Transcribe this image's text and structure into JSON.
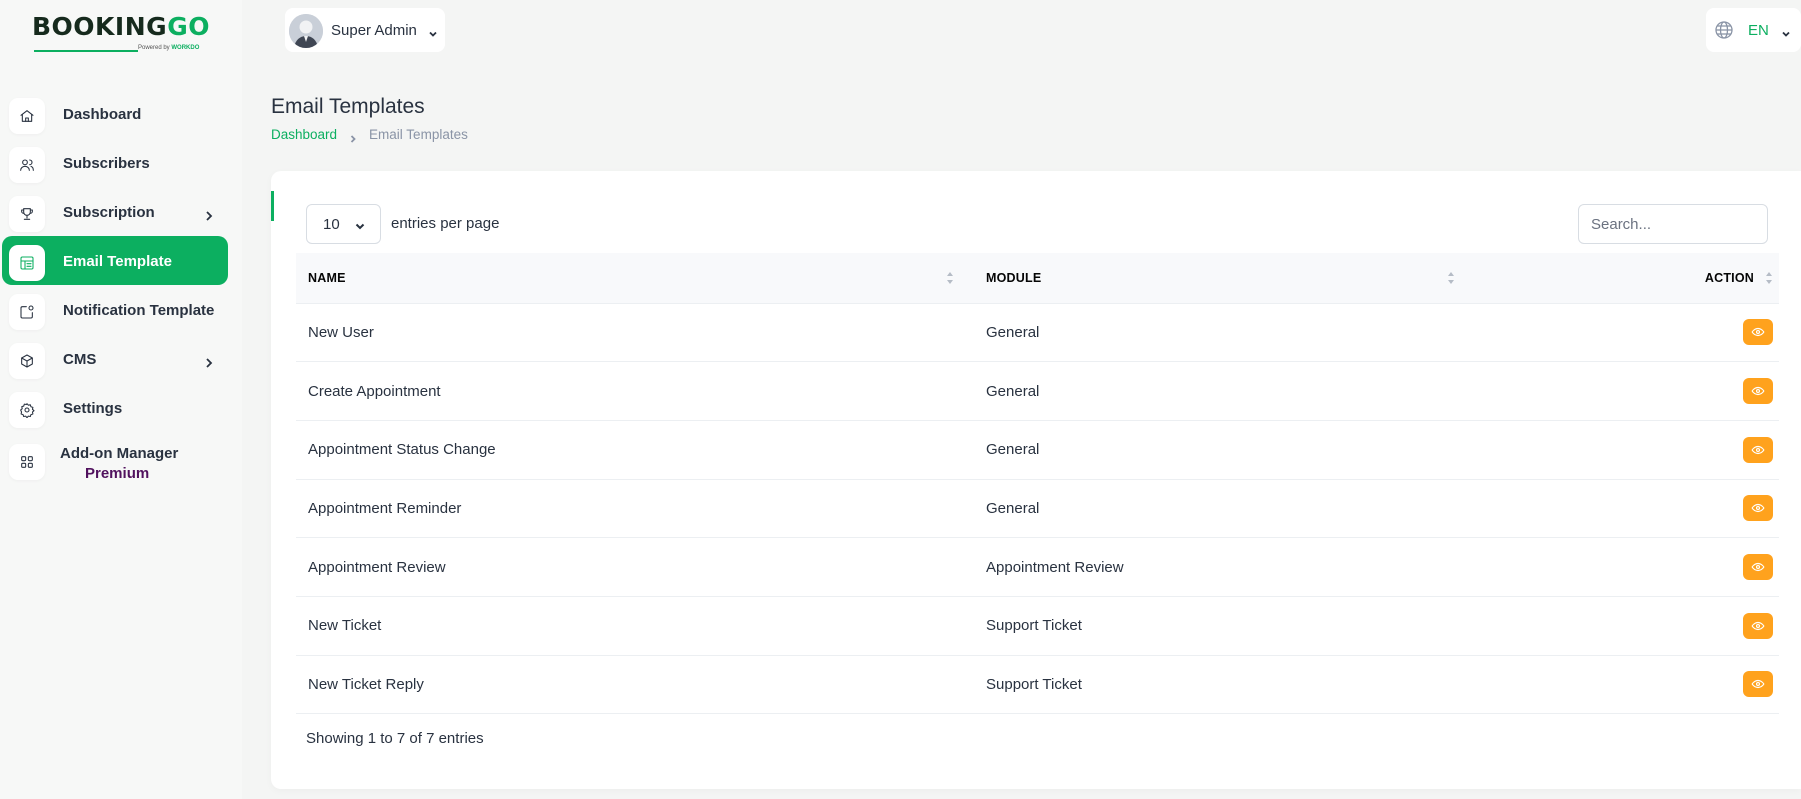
{
  "brand": {
    "logo_main": "BOOKING",
    "logo_accent": "GO",
    "powered_by": "Powered by",
    "powered_brand": "WORKDO"
  },
  "header": {
    "user_name": "Super Admin",
    "language": "EN",
    "accent_color": "#0caf60"
  },
  "sidebar": {
    "items": [
      {
        "label": "Dashboard",
        "icon": "home-icon"
      },
      {
        "label": "Subscribers",
        "icon": "users-icon"
      },
      {
        "label": "Subscription",
        "icon": "trophy-icon",
        "has_submenu": true
      },
      {
        "label": "Email Template",
        "icon": "template-icon",
        "active": true
      },
      {
        "label": "Notification Template",
        "icon": "notification-icon"
      },
      {
        "label": "CMS",
        "icon": "box-icon",
        "has_submenu": true
      },
      {
        "label": "Settings",
        "icon": "gear-icon"
      },
      {
        "label": "Add-on Manager",
        "sub_label": "Premium",
        "icon": "grid-icon"
      }
    ]
  },
  "page": {
    "title": "Email Templates",
    "breadcrumb": {
      "home": "Dashboard",
      "current": "Email Templates"
    }
  },
  "table_controls": {
    "per_page_value": "10",
    "per_page_label": "entries per page",
    "search_placeholder": "Search..."
  },
  "table": {
    "columns": [
      "NAME",
      "MODULE",
      "ACTION"
    ],
    "rows": [
      {
        "name": "New User",
        "module": "General"
      },
      {
        "name": "Create Appointment",
        "module": "General"
      },
      {
        "name": "Appointment Status Change",
        "module": "General"
      },
      {
        "name": "Appointment Reminder",
        "module": "General"
      },
      {
        "name": "Appointment Review",
        "module": "Appointment Review"
      },
      {
        "name": "New Ticket",
        "module": "Support Ticket"
      },
      {
        "name": "New Ticket Reply",
        "module": "Support Ticket"
      }
    ],
    "action_color": "#ffa21d",
    "footer": "Showing 1 to 7 of 7 entries"
  }
}
